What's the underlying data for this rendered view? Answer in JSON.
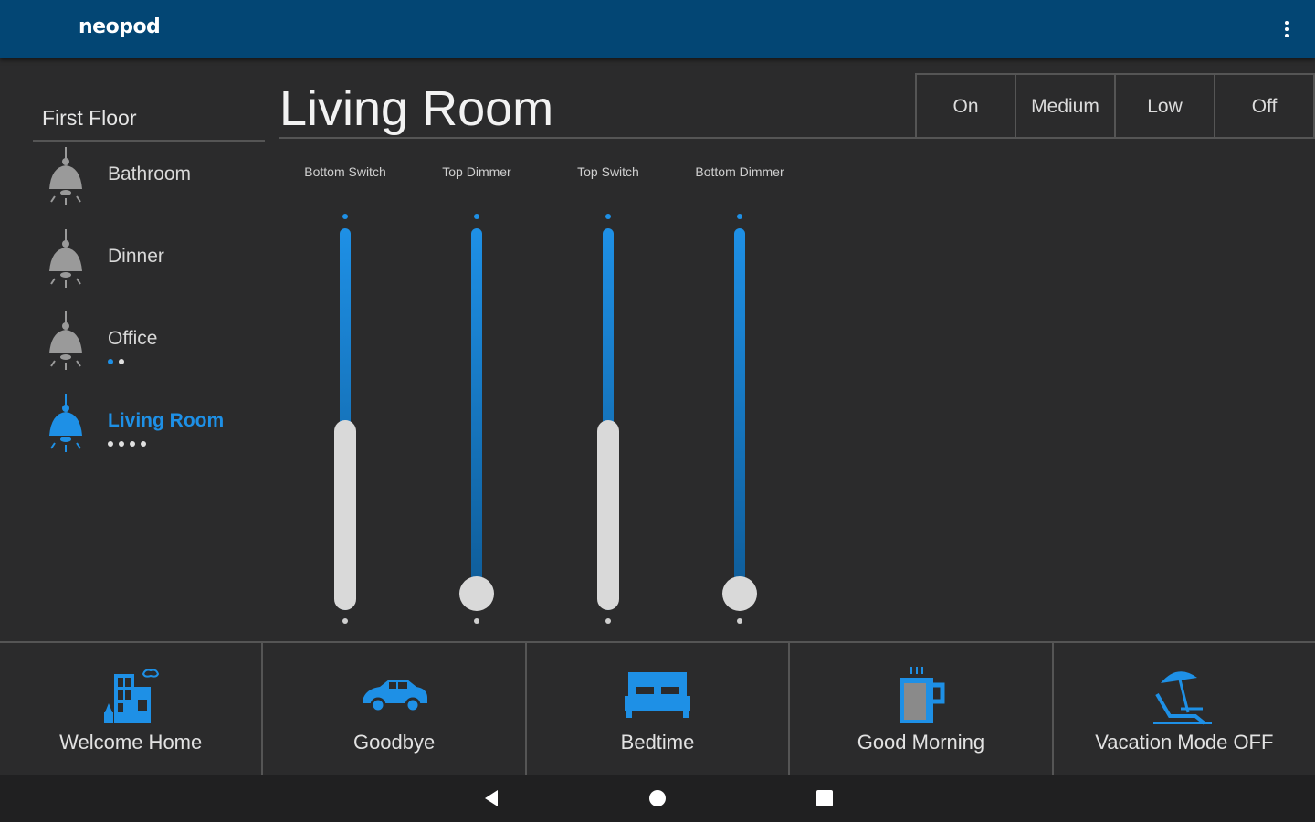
{
  "appbar": {
    "logo": "neopod",
    "menu_icon": "more-vert-icon"
  },
  "sidebar": {
    "floor": "First Floor",
    "rooms": [
      {
        "label": "Bathroom",
        "active": false,
        "dots": []
      },
      {
        "label": "Dinner",
        "active": false,
        "dots": []
      },
      {
        "label": "Office",
        "active": false,
        "dots": [
          "blue",
          "white"
        ]
      },
      {
        "label": "Living Room",
        "active": true,
        "dots": [
          "white",
          "white",
          "white",
          "white"
        ]
      }
    ]
  },
  "room": {
    "title": "Living Room",
    "presets": [
      "On",
      "Medium",
      "Low",
      "Off"
    ]
  },
  "sliders": [
    {
      "label": "Bottom Switch",
      "kind": "switch",
      "value": 0.5
    },
    {
      "label": "Top Dimmer",
      "kind": "dimmer",
      "value": 0.0
    },
    {
      "label": "Top Switch",
      "kind": "switch",
      "value": 0.5
    },
    {
      "label": "Bottom Dimmer",
      "kind": "dimmer",
      "value": 0.0
    }
  ],
  "scenes": [
    {
      "label": "Welcome Home",
      "icon": "house-icon"
    },
    {
      "label": "Goodbye",
      "icon": "car-icon"
    },
    {
      "label": "Bedtime",
      "icon": "bed-icon"
    },
    {
      "label": "Good Morning",
      "icon": "coffee-mug-icon"
    },
    {
      "label": "Vacation Mode OFF",
      "icon": "beach-chair-icon"
    }
  ],
  "colors": {
    "accent": "#1e90e6",
    "appbar": "#034674",
    "background": "#2b2b2c"
  }
}
